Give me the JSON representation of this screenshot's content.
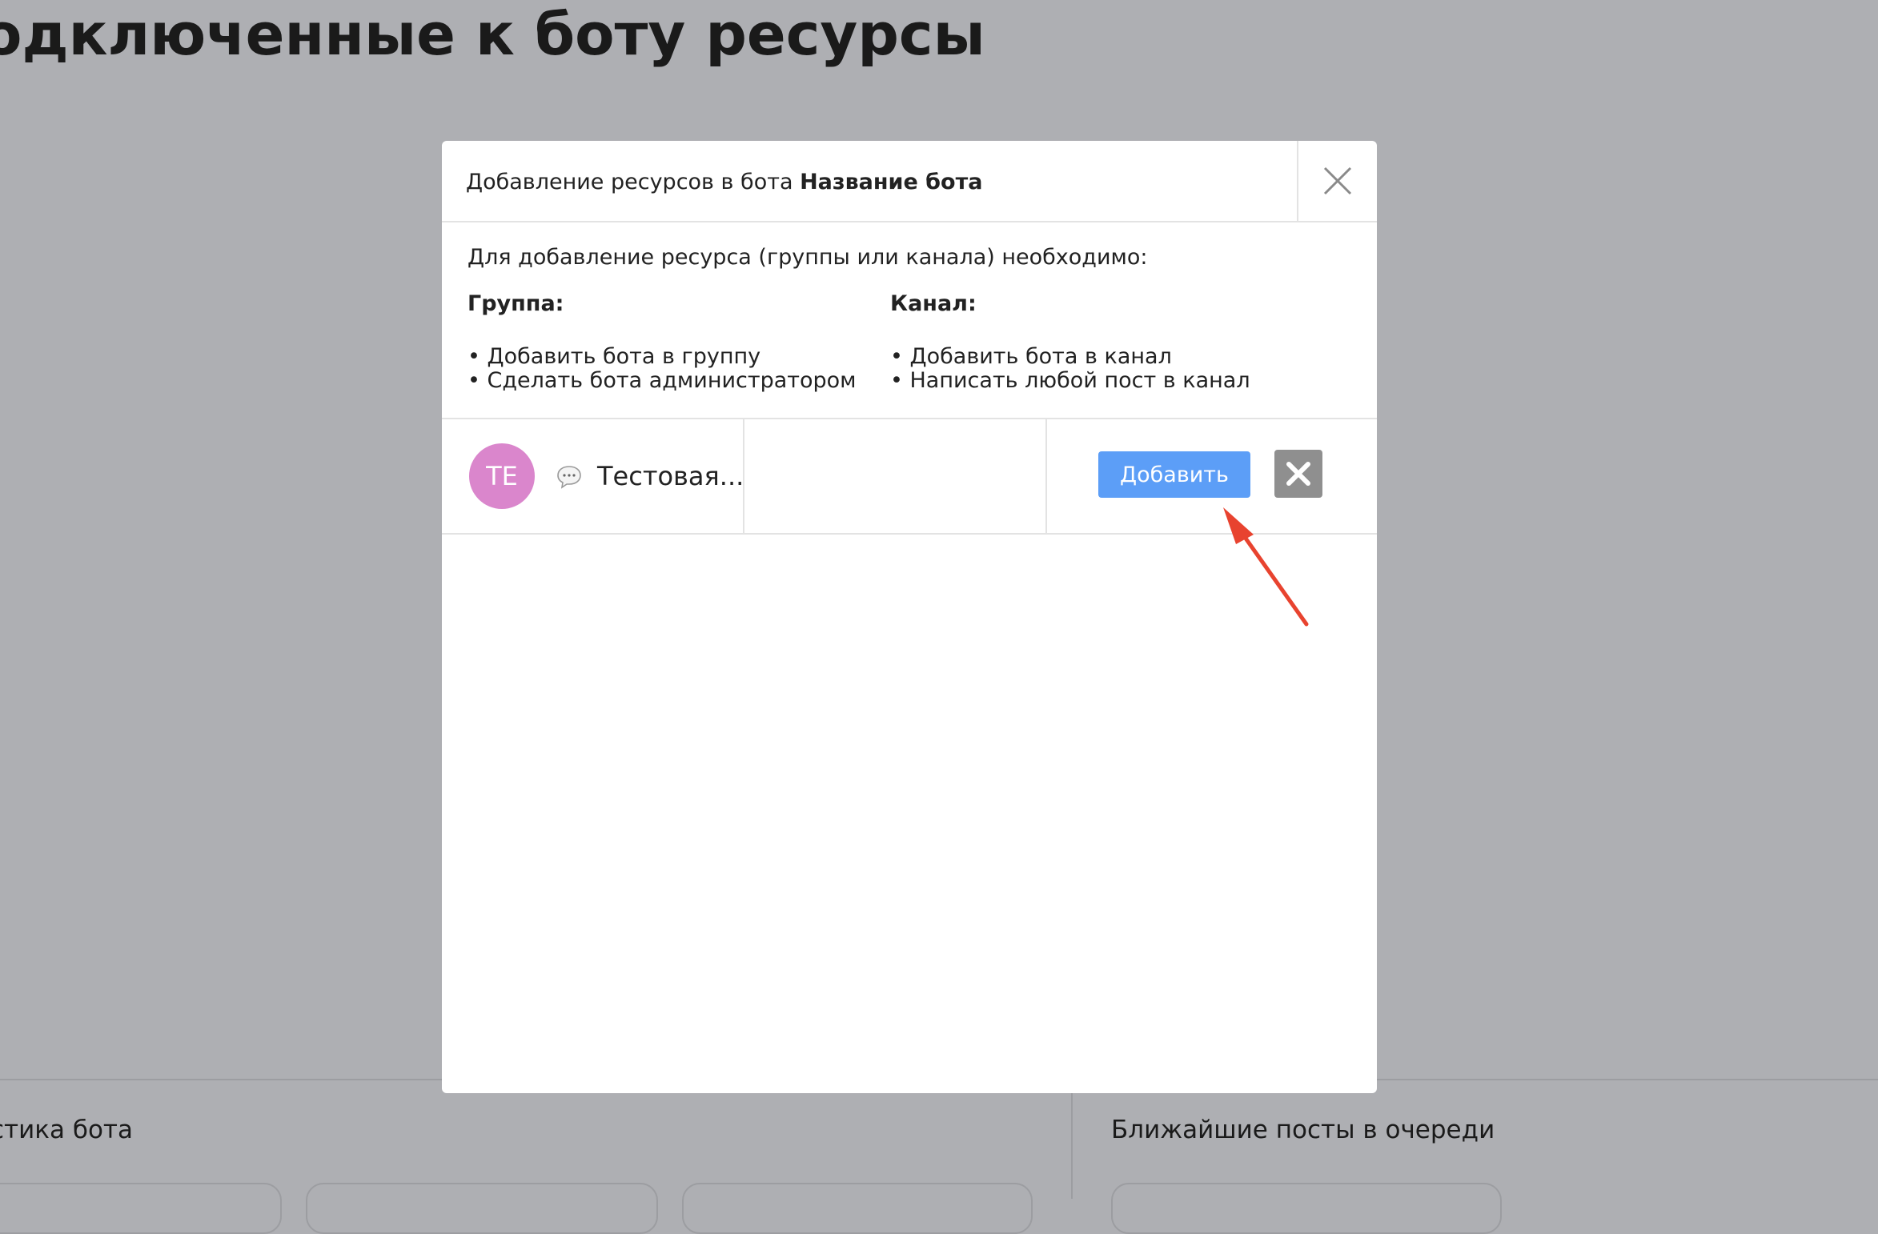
{
  "background": {
    "page_title": "одключенные к боту ресурсы",
    "section_left": "стика бота",
    "section_right": "Ближайшие посты в очереди"
  },
  "modal": {
    "title_prefix": "Добавление ресурсов в бота ",
    "title_bot": "Название бота",
    "info": "Для добавление ресурса (группы или канала) необходимо:",
    "group": {
      "heading": "Группа:",
      "items": [
        "• Добавить бота в группу",
        "• Сделать бота администратором"
      ]
    },
    "channel": {
      "heading": "Канал:",
      "items": [
        "• Добавить бота в канал",
        "• Написать любой пост в канал"
      ]
    },
    "resource": {
      "avatar_initials": "TE",
      "name": "Тестовая...",
      "type_icon": "chat-bubble-icon",
      "add_label": "Добавить"
    }
  },
  "colors": {
    "overlay": "#aeafb3",
    "accent": "#5c9ef7",
    "avatar": "#da86cc",
    "remove": "#8f8f8f",
    "annotation": "#e8432f"
  }
}
